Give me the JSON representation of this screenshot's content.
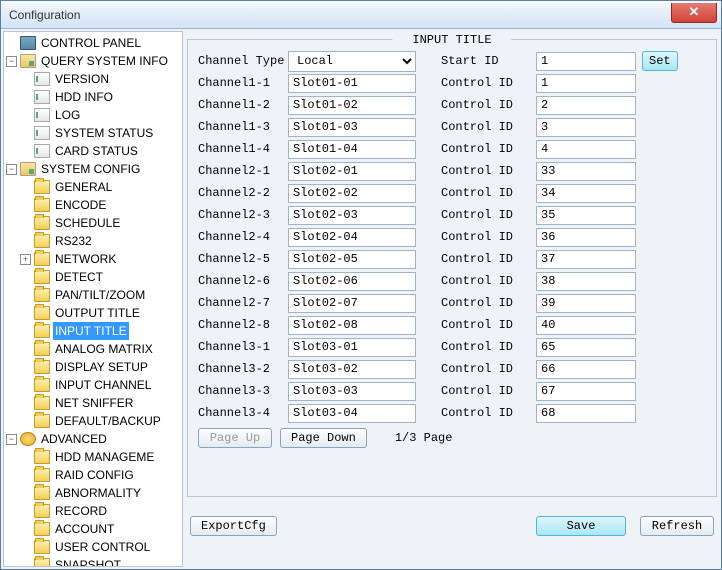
{
  "window": {
    "title": "Configuration"
  },
  "tree": {
    "control_panel": "CONTROL PANEL",
    "query": {
      "label": "QUERY SYSTEM INFO",
      "version": "VERSION",
      "hdd_info": "HDD INFO",
      "log": "LOG",
      "system_status": "SYSTEM STATUS",
      "card_status": "CARD STATUS"
    },
    "system_config": {
      "label": "SYSTEM CONFIG",
      "general": "GENERAL",
      "encode": "ENCODE",
      "schedule": "SCHEDULE",
      "rs232": "RS232",
      "network": "NETWORK",
      "detect": "DETECT",
      "pantilt": "PAN/TILT/ZOOM",
      "output_title": "OUTPUT TITLE",
      "input_title": "INPUT TITLE",
      "analog_matrix": "ANALOG MATRIX",
      "display_setup": "DISPLAY SETUP",
      "input_channel": "INPUT CHANNEL",
      "net_sniffer": "NET SNIFFER",
      "default_backup": "DEFAULT/BACKUP"
    },
    "advanced": {
      "label": "ADVANCED",
      "hdd_management": "HDD MANAGEME",
      "raid_config": "RAID CONFIG",
      "abnormality": "ABNORMALITY",
      "record": "RECORD",
      "account": "ACCOUNT",
      "user_control": "USER CONTROL",
      "snapshot": "SNAPSHOT"
    }
  },
  "panel": {
    "title": "INPUT TITLE",
    "channel_type_label": "Channel Type",
    "channel_type_value": "Local",
    "start_id_label": "Start ID",
    "start_id_value": "1",
    "set_label": "Set",
    "control_id_label": "Control ID",
    "rows": [
      {
        "ch": "Channel1-1",
        "slot": "Slot01-01",
        "cid": "1"
      },
      {
        "ch": "Channel1-2",
        "slot": "Slot01-02",
        "cid": "2"
      },
      {
        "ch": "Channel1-3",
        "slot": "Slot01-03",
        "cid": "3"
      },
      {
        "ch": "Channel1-4",
        "slot": "Slot01-04",
        "cid": "4"
      },
      {
        "ch": "Channel2-1",
        "slot": "Slot02-01",
        "cid": "33"
      },
      {
        "ch": "Channel2-2",
        "slot": "Slot02-02",
        "cid": "34"
      },
      {
        "ch": "Channel2-3",
        "slot": "Slot02-03",
        "cid": "35"
      },
      {
        "ch": "Channel2-4",
        "slot": "Slot02-04",
        "cid": "36"
      },
      {
        "ch": "Channel2-5",
        "slot": "Slot02-05",
        "cid": "37"
      },
      {
        "ch": "Channel2-6",
        "slot": "Slot02-06",
        "cid": "38"
      },
      {
        "ch": "Channel2-7",
        "slot": "Slot02-07",
        "cid": "39"
      },
      {
        "ch": "Channel2-8",
        "slot": "Slot02-08",
        "cid": "40"
      },
      {
        "ch": "Channel3-1",
        "slot": "Slot03-01",
        "cid": "65"
      },
      {
        "ch": "Channel3-2",
        "slot": "Slot03-02",
        "cid": "66"
      },
      {
        "ch": "Channel3-3",
        "slot": "Slot03-03",
        "cid": "67"
      },
      {
        "ch": "Channel3-4",
        "slot": "Slot03-04",
        "cid": "68"
      }
    ],
    "page_up": "Page Up",
    "page_down": "Page Down",
    "page_info": "1/3 Page",
    "export_cfg": "ExportCfg",
    "save": "Save",
    "refresh": "Refresh"
  }
}
